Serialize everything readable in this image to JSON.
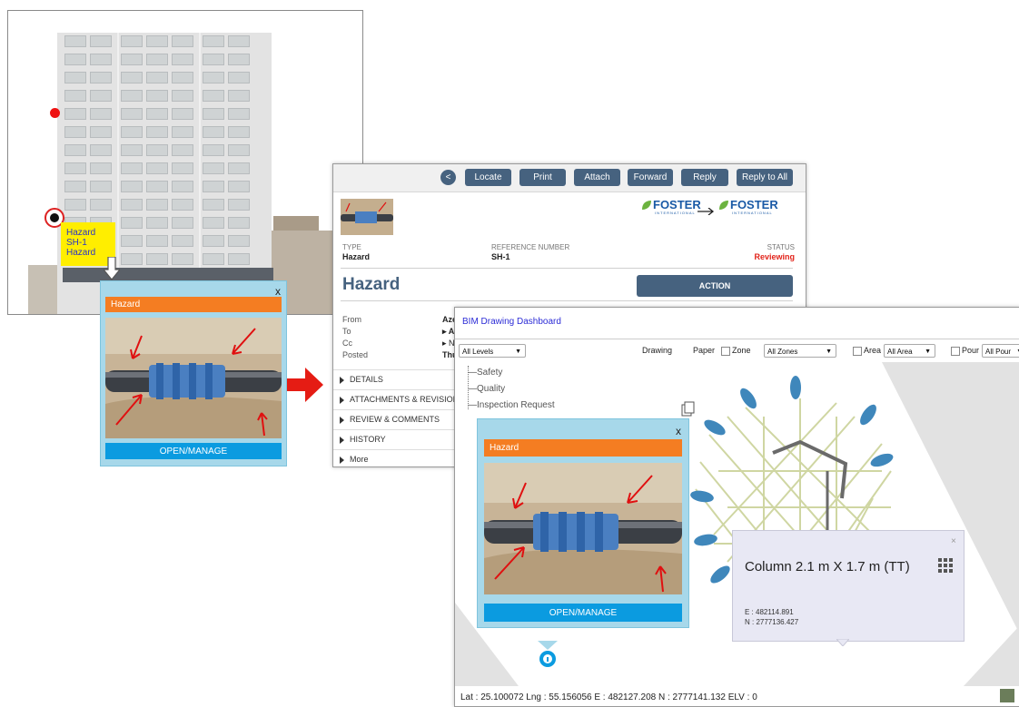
{
  "colors": {
    "accent_orange": "#f47d22",
    "open_button_blue": "#0b9be0",
    "toolbar_slate": "#46627f",
    "status_red": "#e2231a",
    "tag_yellow": "#ffee00",
    "bim_link_blue": "#2b2bd6"
  },
  "elevation_tag": {
    "line1": "Hazard",
    "line2": "SH-1",
    "line3": "Hazard"
  },
  "popup1": {
    "close": "x",
    "header": "Hazard",
    "open_label": "OPEN/MANAGE"
  },
  "detail": {
    "toolbar": {
      "back": "<",
      "locate": "Locate",
      "print": "Print",
      "attach": "Attach",
      "forward": "Forward",
      "reply": "Reply",
      "reply_all": "Reply to All"
    },
    "from_logo": "FOSTER",
    "from_logo_sub": "INTERNATIONAL",
    "to_logo": "FOSTER",
    "to_logo_sub": "INTERNATIONAL",
    "type_label": "TYPE",
    "type_value": "Hazard",
    "ref_label": "REFERENCE NUMBER",
    "ref_value": "SH-1",
    "status_label": "STATUS",
    "status_value": "Reviewing",
    "title": "Hazard",
    "action_label": "ACTION",
    "meta": {
      "from_label": "From",
      "from_value": "Aze",
      "to_label": "To",
      "to_value": "A",
      "cc_label": "Cc",
      "cc_value": "N",
      "posted_label": "Posted",
      "posted_value": "Thu"
    },
    "sections": [
      "DETAILS",
      "ATTACHMENTS & REVISION",
      "REVIEW & COMMENTS",
      "HISTORY",
      "More"
    ]
  },
  "bim": {
    "title": "BIM Drawing Dashboard",
    "levels": "All Levels",
    "drawing": "Drawing",
    "paper": "Paper",
    "zone_label": "Zone",
    "zone_value": "All Zones",
    "area_label": "Area",
    "area_value": "All Area",
    "pour_label": "Pour",
    "pour_value": "All Pour",
    "tree": [
      "Safety",
      "Quality",
      "Inspection Request"
    ],
    "column_popup": {
      "close": "×",
      "title": "Column 2.1 m X 1.7 m (TT)",
      "e": "E : 482114.891",
      "n": "N : 2777136.427"
    },
    "status": "Lat : 25.100072  Lng : 55.156056  E : 482127.208  N : 2777141.132  ELV : 0"
  },
  "popup3": {
    "close": "x",
    "header": "Hazard",
    "open_label": "OPEN/MANAGE"
  }
}
